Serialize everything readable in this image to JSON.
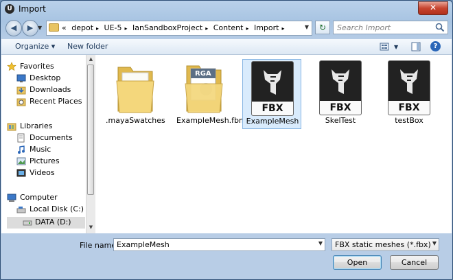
{
  "window": {
    "title": "Import",
    "app_icon": "unreal-engine-icon"
  },
  "address_bar": {
    "prefix": "«",
    "crumbs": [
      "depot",
      "UE-5",
      "IanSandboxProject",
      "Content",
      "Import"
    ],
    "separator": "▸",
    "search_placeholder": "Search Import"
  },
  "toolbar": {
    "organize_label": "Organize ▾",
    "new_folder_label": "New folder"
  },
  "nav": {
    "favorites": {
      "label": "Favorites",
      "items": [
        "Desktop",
        "Downloads",
        "Recent Places"
      ]
    },
    "libraries": {
      "label": "Libraries",
      "items": [
        "Documents",
        "Music",
        "Pictures",
        "Videos"
      ]
    },
    "computer": {
      "label": "Computer",
      "items": [
        "Local Disk (C:)",
        "DATA (D:)"
      ]
    }
  },
  "files": [
    {
      "name": ".mayaSwatches",
      "type": "folder"
    },
    {
      "name": "ExampleMesh.fbm",
      "type": "folder-with-content",
      "badge": "RGA"
    },
    {
      "name": "ExampleMesh",
      "type": "fbx",
      "badge": "FBX",
      "selected": true
    },
    {
      "name": "SkelTest",
      "type": "fbx",
      "badge": "FBX"
    },
    {
      "name": "testBox",
      "type": "fbx",
      "badge": "FBX"
    }
  ],
  "bottom": {
    "file_name_label": "File name:",
    "file_name_value": "ExampleMesh",
    "filter_value": "FBX static meshes (*.fbx)",
    "open_label": "Open",
    "cancel_label": "Cancel"
  },
  "colors": {
    "selection": "#d9ebfc",
    "selection_border": "#87b5e3",
    "close_button": "#c7452f",
    "folder": "#e8c463"
  }
}
